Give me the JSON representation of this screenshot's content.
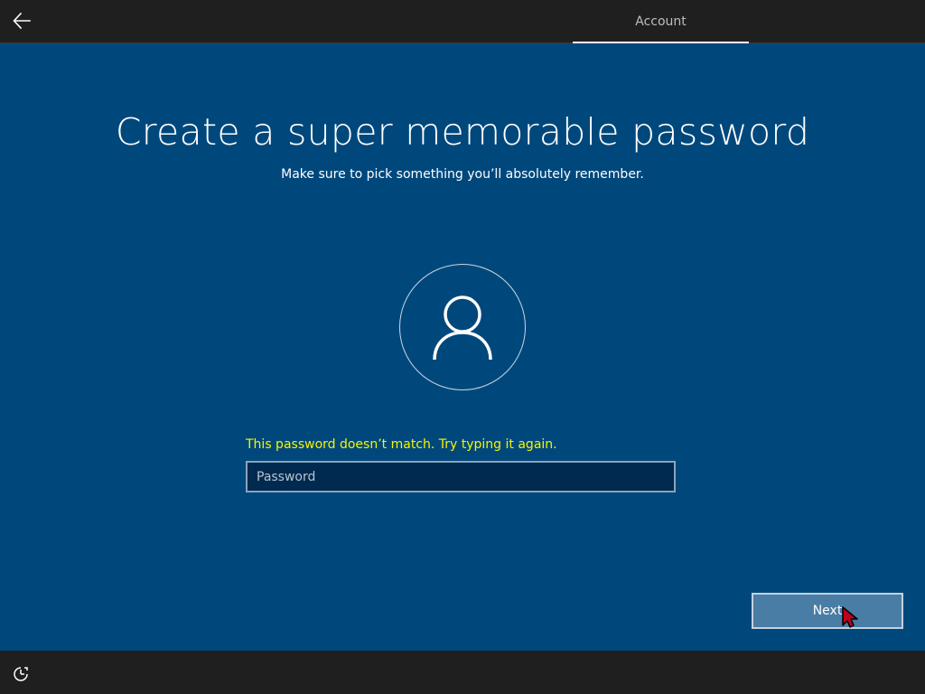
{
  "header": {
    "back_icon": "arrow-left-icon",
    "active_tab": "Account"
  },
  "main": {
    "title": "Create a super memorable password",
    "subtitle": "Make sure to pick something you’ll absolutely remember.",
    "avatar_icon": "user-icon",
    "error_message": "This password doesn’t match. Try typing it again.",
    "password": {
      "value": "",
      "placeholder": "Password"
    },
    "next_label": "Next"
  },
  "footer": {
    "accessibility_icon": "ease-of-access-icon"
  },
  "colors": {
    "background": "#00487c",
    "bars": "#1f1f1f",
    "error": "#f5f500"
  }
}
